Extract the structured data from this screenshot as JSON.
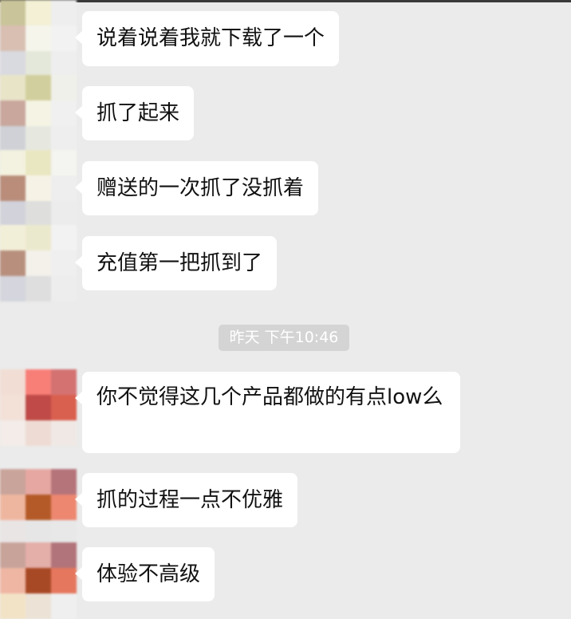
{
  "chat": {
    "messages": [
      {
        "text": "说着说着我就下载了一个"
      },
      {
        "text": "抓了起来"
      },
      {
        "text": "赠送的一次抓了没抓着"
      },
      {
        "text": "充值第一把抓到了"
      },
      {
        "text": "你不觉得这几个产品都做的有点low么"
      },
      {
        "text": "抓的过程一点不优雅"
      },
      {
        "text": "体验不高级"
      }
    ],
    "timestamp": "昨天 下午10:46"
  }
}
